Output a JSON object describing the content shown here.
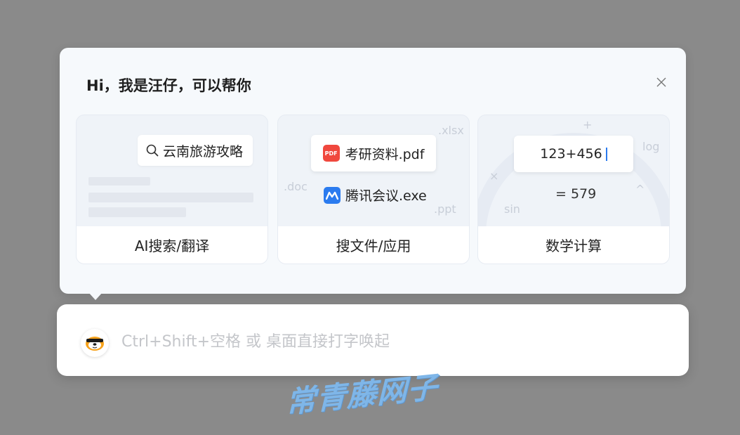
{
  "panel": {
    "greeting": "Hi，我是汪仔，可以帮你",
    "close_icon": "close-icon"
  },
  "cards": [
    {
      "label": "AI搜索/翻译",
      "search_text": "云南旅游攻略",
      "icon": "search-icon"
    },
    {
      "label": "搜文件/应用",
      "file1": "考研资料.pdf",
      "file1_badge": "PDF",
      "file2": "腾讯会议.exe",
      "ghost_ext": [
        ".xlsx",
        ".doc",
        ".ppt"
      ]
    },
    {
      "label": "数学计算",
      "expression": "123+456",
      "result": "= 579",
      "ghost_symbols": [
        "+",
        "log",
        "×",
        "^",
        "sin"
      ]
    }
  ],
  "inputbar": {
    "placeholder": "Ctrl+Shift+空格 或 桌面直接打字唤起"
  },
  "watermark": "常青藤网子",
  "colors": {
    "accent": "#2b7bef",
    "pdf": "#f0483e"
  }
}
